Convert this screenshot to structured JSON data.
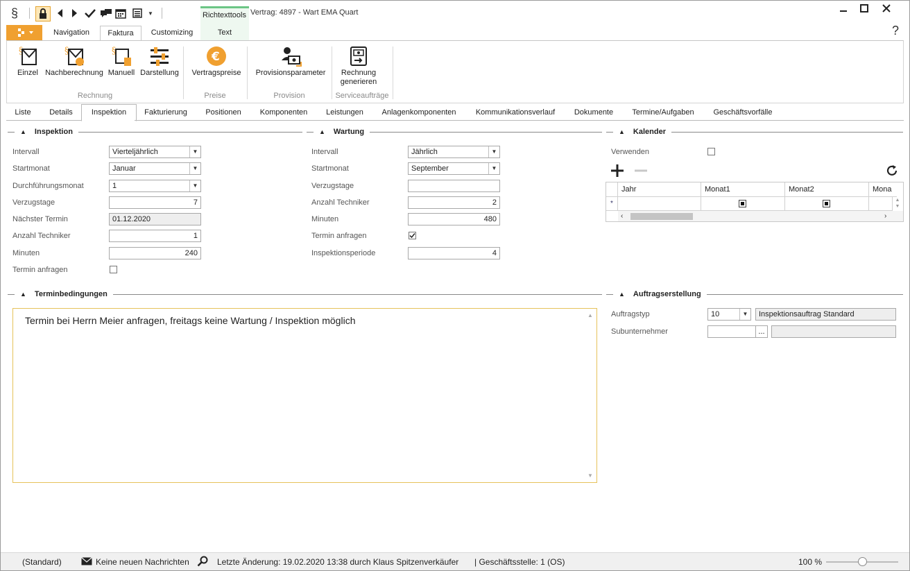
{
  "window": {
    "title": "Vertrag: 4897 - Wart EMA Quart",
    "context_tab_group": "Richtexttools"
  },
  "ribbon_tabs": [
    "Navigation",
    "Faktura",
    "Customizing",
    "Text"
  ],
  "ribbon": {
    "buttons": {
      "einzel": "Einzel",
      "nachberechnung": "Nachberechnung",
      "manuell": "Manuell",
      "darstellung": "Darstellung",
      "vertragspreise": "Vertragspreise",
      "provisionsparameter": "Provisionsparameter",
      "rechnung_line1": "Rechnung",
      "rechnung_line2": "generieren"
    },
    "groups": {
      "rechnung": "Rechnung",
      "preise": "Preise",
      "provision": "Provision",
      "serviceauftraege": "Serviceaufträge"
    },
    "help": "?"
  },
  "page_tabs": [
    "Liste",
    "Details",
    "Inspektion",
    "Fakturierung",
    "Positionen",
    "Komponenten",
    "Leistungen",
    "Anlagenkomponenten",
    "Kommunikationsverlauf",
    "Dokumente",
    "Termine/Aufgaben",
    "Geschäftsvorfälle"
  ],
  "inspektion": {
    "title": "Inspektion",
    "intervall_label": "Intervall",
    "intervall": "Vierteljährlich",
    "startmonat_label": "Startmonat",
    "startmonat": "Januar",
    "durchfuehrung_label": "Durchführungsmonat",
    "durchfuehrung": "1",
    "verzugstage_label": "Verzugstage",
    "verzugstage": "7",
    "naechster_label": "Nächster Termin",
    "naechster": "01.12.2020",
    "techniker_label": "Anzahl Techniker",
    "techniker": "1",
    "minuten_label": "Minuten",
    "minuten": "240",
    "termin_label": "Termin anfragen"
  },
  "wartung": {
    "title": "Wartung",
    "intervall_label": "Intervall",
    "intervall": "Jährlich",
    "startmonat_label": "Startmonat",
    "startmonat": "September",
    "verzugstage_label": "Verzugstage",
    "verzugstage": "",
    "techniker_label": "Anzahl Techniker",
    "techniker": "2",
    "minuten_label": "Minuten",
    "minuten": "480",
    "termin_label": "Termin anfragen",
    "periode_label": "Inspektionsperiode",
    "periode": "4"
  },
  "kalender": {
    "title": "Kalender",
    "verwenden_label": "Verwenden",
    "columns": [
      "Jahr",
      "Monat1",
      "Monat2",
      "Mona"
    ],
    "new_row_marker": "*"
  },
  "terminbedingungen": {
    "title": "Terminbedingungen",
    "text": "Termin bei Herrn Meier anfragen, freitags keine Wartung / Inspektion möglich"
  },
  "auftragserstellung": {
    "title": "Auftragserstellung",
    "auftragstyp_label": "Auftragstyp",
    "auftragstyp": "10",
    "auftragstyp_name": "Inspektionsauftrag Standard",
    "sub_label": "Subunternehmer",
    "sub": "",
    "sub_btn": "...",
    "sub_name": ""
  },
  "status": {
    "profile": "(Standard)",
    "messages": "Keine neuen Nachrichten",
    "last_change": "Letzte Änderung: 19.02.2020 13:38 durch Klaus Spitzenverkäufer",
    "branch": "| Geschäftsstelle:  1 (OS)",
    "zoom": "100 %",
    "zoom_level": 0.5
  },
  "colors": {
    "accent_orange": "#f0a030",
    "tool_green": "#6cc585",
    "memo_border": "#e6c25a"
  }
}
